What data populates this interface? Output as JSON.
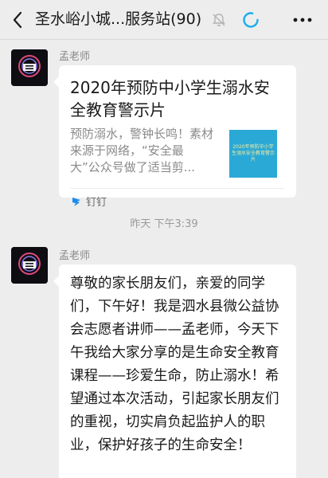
{
  "header": {
    "title": "圣水峪小城...服务站(90)",
    "icons": [
      "back-icon",
      "mute-icon",
      "loading-icon",
      "more-icon"
    ]
  },
  "messages": [
    {
      "sender": "孟老师",
      "type": "link_card",
      "card": {
        "title": "2020年预防中小学生溺水安全教育警示片",
        "description": "预防溺水，警钟长鸣！素材来源于网络，“安全最大”公众号做了适当剪...",
        "thumbnail_text": "2020年预防中小学生溺水安全教育警示片",
        "thumbnail_color": "#2aa9d6",
        "source": "钉钉",
        "source_icon": "dingtalk-icon"
      }
    },
    {
      "sender": "孟老师",
      "type": "text",
      "text": "尊敬的家长朋友们，亲爱的同学们，下午好！我是泗水县微公益协会志愿者讲师——孟老师，今天下午我给大家分享的是生命安全教育课程——珍爱生命，防止溺水！希望通过本次活动，引起家长朋友们的重视，切实肩负起监护人的职业，保护好孩子的生命安全！"
    }
  ],
  "timestamp": "昨天 下午3:39",
  "colors": {
    "background": "#ededed",
    "bubble": "#ffffff",
    "accent": "#1aadee"
  }
}
